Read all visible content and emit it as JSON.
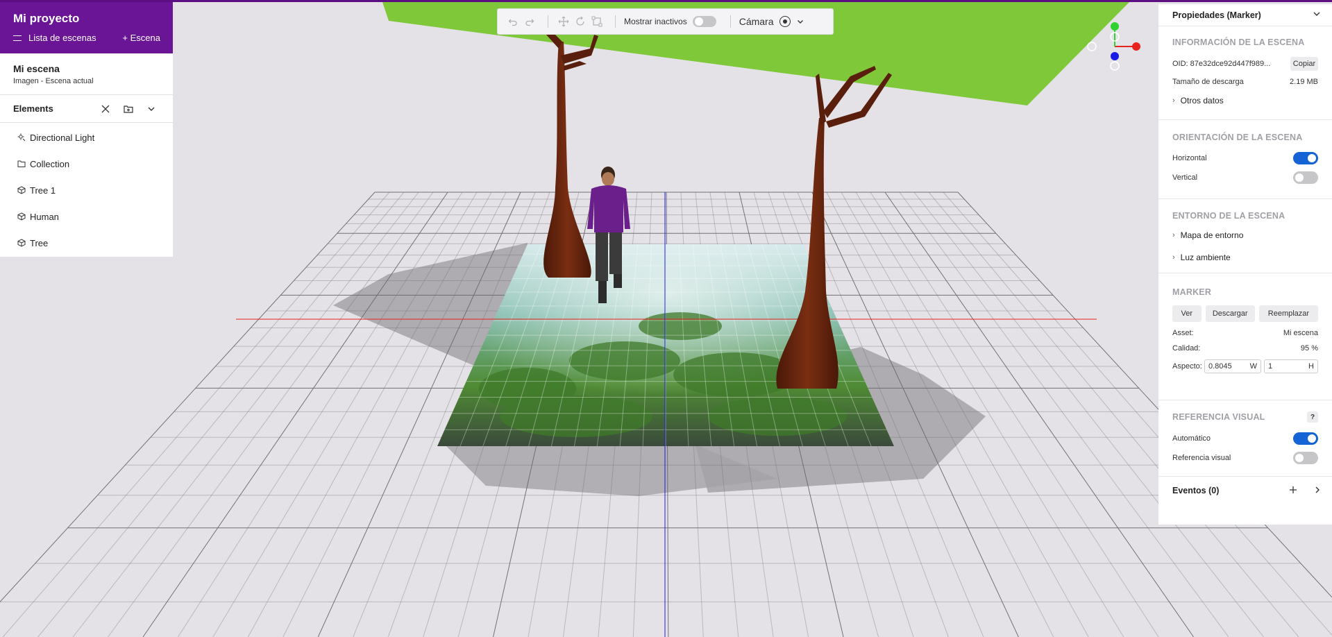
{
  "project": {
    "title": "Mi proyecto",
    "scene_list_label": "Lista de escenas",
    "add_scene_label": "+ Escena"
  },
  "scene": {
    "name": "Mi escena",
    "subtitle": "Imagen - Escena actual"
  },
  "elements": {
    "title": "Elements",
    "items": [
      {
        "label": "Directional Light",
        "icon": "light-icon"
      },
      {
        "label": "Collection",
        "icon": "folder-icon"
      },
      {
        "label": "Tree 1",
        "icon": "cube-icon"
      },
      {
        "label": "Human",
        "icon": "cube-icon"
      },
      {
        "label": "Tree",
        "icon": "cube-icon"
      }
    ]
  },
  "toolbar": {
    "show_inactive_label": "Mostrar inactivos",
    "show_inactive_on": false,
    "camera_label": "Cámara"
  },
  "properties": {
    "title": "Propiedades (Marker)",
    "info": {
      "title": "INFORMACIÓN DE LA ESCENA",
      "oid_label": "OID: 87e32dce92d447f989...",
      "copy_label": "Copiar",
      "download_size_label": "Tamaño de descarga",
      "download_size_value": "2.19 MB",
      "other_data_label": "Otros datos"
    },
    "orientation": {
      "title": "ORIENTACIÓN DE LA ESCENA",
      "horizontal_label": "Horizontal",
      "horizontal_on": true,
      "vertical_label": "Vertical",
      "vertical_on": false
    },
    "environment": {
      "title": "ENTORNO DE LA ESCENA",
      "env_map_label": "Mapa de entorno",
      "ambient_light_label": "Luz ambiente"
    },
    "marker": {
      "title": "MARKER",
      "view_label": "Ver",
      "download_label": "Descargar",
      "replace_label": "Reemplazar",
      "asset_label": "Asset:",
      "asset_value": "Mi escena",
      "quality_label": "Calidad:",
      "quality_value": "95 %",
      "aspect_label": "Aspecto:",
      "aspect_w": "0.8045",
      "aspect_w_unit": "W",
      "aspect_h": "1",
      "aspect_h_unit": "H"
    },
    "visual_ref": {
      "title": "REFERENCIA VISUAL",
      "help": "?",
      "auto_label": "Automático",
      "auto_on": true,
      "ref_label": "Referencia visual",
      "ref_on": false
    },
    "events_label": "Eventos (0)"
  },
  "colors": {
    "brand_purple": "#6a1596",
    "toggle_blue": "#1564d6",
    "gizmo_x": "#e8231e",
    "gizmo_y": "#2ed12e",
    "gizmo_z": "#1a1ae6"
  }
}
